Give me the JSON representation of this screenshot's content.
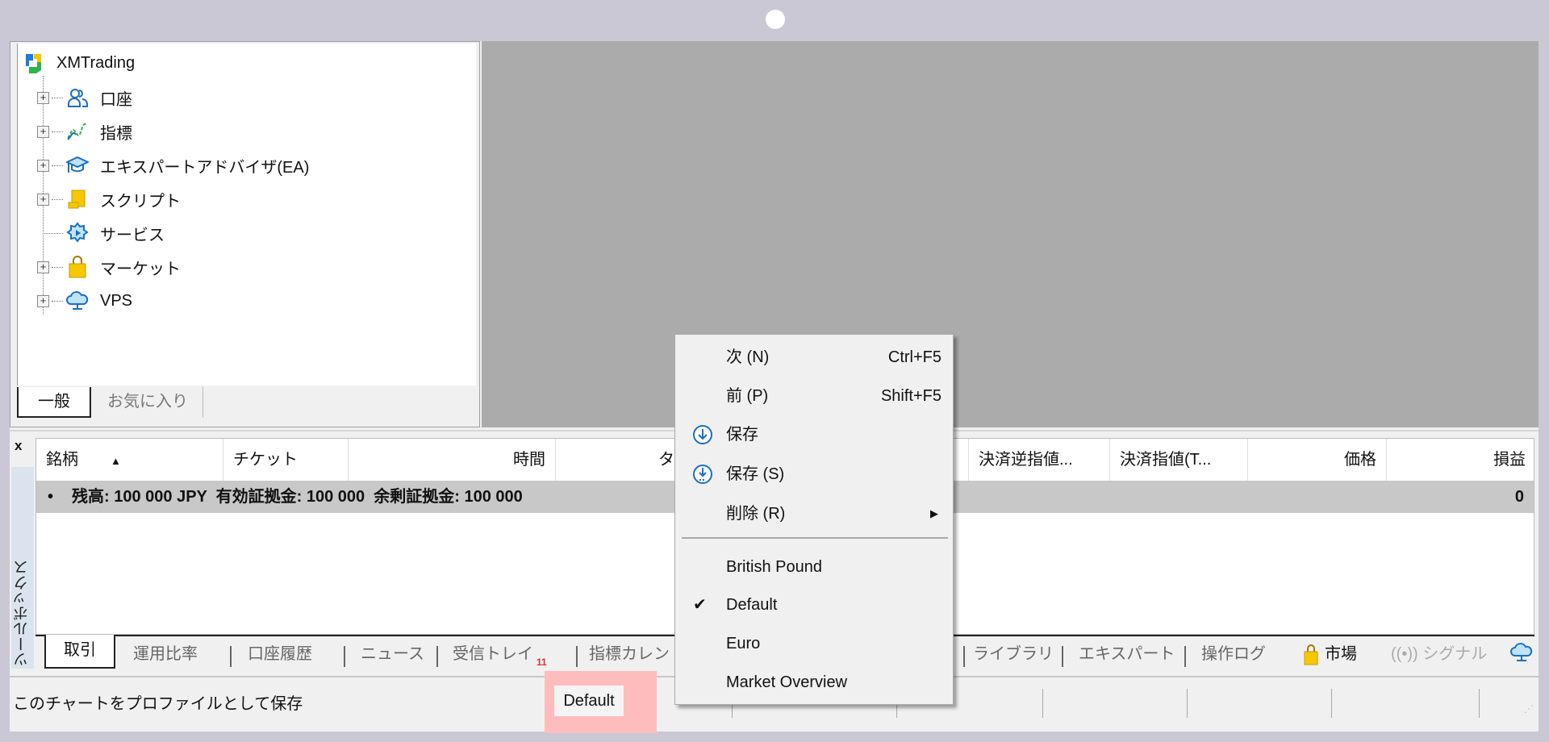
{
  "navigator": {
    "root": "XMTrading",
    "items": [
      {
        "label": "口座",
        "icon": "accounts-icon",
        "expandable": true
      },
      {
        "label": "指標",
        "icon": "indicators-icon",
        "expandable": true
      },
      {
        "label": "エキスパートアドバイザ(EA)",
        "icon": "expert-advisor-icon",
        "expandable": true
      },
      {
        "label": "スクリプト",
        "icon": "scripts-icon",
        "expandable": true
      },
      {
        "label": "サービス",
        "icon": "services-icon",
        "expandable": false
      },
      {
        "label": "マーケット",
        "icon": "market-bag-icon",
        "expandable": true
      },
      {
        "label": "VPS",
        "icon": "vps-cloud-icon",
        "expandable": true
      }
    ],
    "tabs": [
      "一般",
      "お気に入り"
    ],
    "expand_symbol": "+"
  },
  "toolbox": {
    "close": "x",
    "vertical_label": "ツールボックス",
    "columns": [
      "銘柄",
      "チケット",
      "時間",
      "タイプ",
      "決済逆指値...",
      "決済指値(T...",
      "価格",
      "損益"
    ],
    "sort_indicator": "▲",
    "balance_bullet": "•",
    "balance_text": "残高: 100 000 JPY  有効証拠金: 100 000  余剰証拠金: 100 000",
    "profit": "0",
    "tabs": [
      "取引",
      "運用比率",
      "口座履歴",
      "ニュース",
      "受信トレイ",
      "指標カレン",
      "ライブラリ",
      "エキスパート",
      "操作ログ",
      "市場",
      "((•)) シグナル"
    ],
    "inbox_badge": "11"
  },
  "status_bar": {
    "message": "このチャートをプロファイルとして保存",
    "profile": "Default",
    "highlight_color": "#ffbcbc"
  },
  "context_menu": {
    "items": [
      {
        "label": "次 (N)",
        "shortcut": "Ctrl+F5"
      },
      {
        "label": "前 (P)",
        "shortcut": "Shift+F5"
      },
      {
        "label": "保存",
        "icon": "save-icon"
      },
      {
        "label": "保存 (S)",
        "icon": "save-as-icon"
      },
      {
        "label": "削除 (R)",
        "submenu": true,
        "arrow": "▶"
      },
      {
        "label": "British Pound"
      },
      {
        "label": "Default",
        "checked": true,
        "check": "✔"
      },
      {
        "label": "Euro"
      },
      {
        "label": "Market Overview"
      }
    ]
  }
}
